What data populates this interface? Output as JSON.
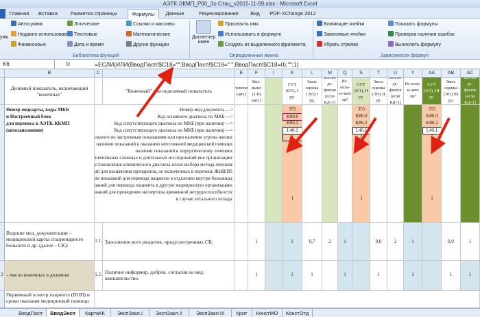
{
  "window": {
    "title": "АЭТК-ЭКМП_P00_Зх-Стац_v2015-11-09.xlsx - Microsoft Excel"
  },
  "ribbon_tabs": [
    "Главная",
    "Вставка",
    "Разметка страницы",
    "Формулы",
    "Данные",
    "Рецензирование",
    "Вид",
    "PDF-XChange 2012"
  ],
  "ribbon": {
    "lib": {
      "autosum": "Автосумма",
      "recent": "Недавно использовавше",
      "financial": "Финансовые",
      "logical": "Логические",
      "text": "Текстовые",
      "datetime": "Дата и время",
      "links": "Ссылки и массивы",
      "math": "Математические",
      "other": "Другие функции",
      "label": "Библиотека функций",
      "insert_fn": "ункци"
    },
    "names": {
      "manager": "Диспетчер имен",
      "assign": "Присвоить имя",
      "use": "Использовать в формуле",
      "create": "Создать из выделенного фрагмента",
      "label": "Определенные имена"
    },
    "audit": {
      "precedents": "Влияющие ячейки",
      "dependents": "Зависимые ячейки",
      "remove": "Убрать стрелки",
      "show": "Показать формулы",
      "check": "Проверка наличия ошибок",
      "evaluate": "Вычислить формулу",
      "label": "Зависимости формул"
    }
  },
  "formula_bar": {
    "name_box": "K6",
    "fx": "fx",
    "formula": "=ЕСЛИ(ИЛИ(ВводПасп!$C18=\"\";ВводПасп!$C18=\" \";ВводПасп!$C18=0);\"\";1)"
  },
  "columns": [
    "B",
    "C",
    "D",
    "E",
    "F",
    "I",
    "K",
    "L",
    "M",
    "Q",
    "S",
    "T",
    "U",
    "Y",
    "AA",
    "AB",
    "AC"
  ],
  "headers": {
    "col_b": "Делимый показатель, включающий \"конечные\"",
    "col_d": "\"Конечный\" или неделимый показатель",
    "col_e": "Отключен? (авт.)",
    "col_f": "Вкл. выкл (1/0) (авт.)",
    "sut1": "СУТ (0/1), I ур.",
    "eks1": "Эксп. оценка (ЭО) I ур.",
    "kol1": "Кол-во де-фектов (если КД>1)",
    "isp1": "Ис-поль-зо-вать ли?",
    "sut2": "СУТ (0/1), II ур.",
    "eks2": "Эксп. оценка (ЭО) II ур.",
    "kol2": "Кол-во де-фектов (если КД>1)",
    "isp2": "Ис-поль-зо-вать ли?",
    "sut3": "СУТ (0/1), III ур.",
    "eks3": "Эксп. оценка (ЭО) III ур.",
    "kol3": "Кол-во де-фектов (если КД>1)",
    "isp3": "Ис-поль-зо-вать ли?"
  },
  "left_labels": [
    "Номер медкарты, коды МКБ",
    "и Настроечный блок",
    "для переноса в АЭТК-ККМП",
    "(автозаполнение)"
  ],
  "right_labels": [
    "Номер мед.документа --->",
    "Код основного диагноза по МКБ --->",
    "Код сопутствующего диагноза по МКБ (при наличии) --->",
    "Код сопутствующего диагноза по МКБ (при наличии) --->",
    "поступления больного по экстренным показаниям или при наличии угрозы жизни:",
    "наличии показаний к оказанию неотложной медицинской помощи:",
    "наличии показаний к хирургическому лечению:",
    "необходимости проведения дополнительных сложных и длительных исследований вне организации:",
    "наличии затруднений установления клинического диагноза и/или выбора метода лечения:",
    "наличии показаний для назначения препаратов, не включенных в перечень ЖНВЛП:",
    "наличии показаний для перевода пациента в отделение внутри больницы:",
    "наличии показаний для перевода пациента в другую медицинскую организацию:",
    "наличии оснований для проведения экспертизы временной нетрудоспособности:",
    "в случае летального исхода:"
  ],
  "codes": {
    "doc": "355",
    "main": "K80.0",
    "sub1": "K86.2",
    "sub2": "L40.1",
    "one": "1"
  },
  "row1": {
    "b": "Ведение мед. документации – медицинской карты стационарного больного и др. (далее – СК):",
    "c": "1.1.",
    "d": "Заполнение всех разделов, предусмотренных СК;",
    "e": "",
    "f": "1",
    "sut1": "1",
    "eks1": "0,7",
    "kol1": "2",
    "isp1": "1",
    "sut2": "",
    "eks2": "0,8",
    "kol2": "2",
    "isp2": "1",
    "sut3": "",
    "eks3": "0,9",
    "kol3": "1",
    "isp3": "1"
  },
  "row2": {
    "a": "2",
    "b": "- число конечных в делимом",
    "c": "1.2.",
    "d": "Наличие информир. добров. согласия на мед. вмешательство.",
    "f": "1",
    "sut1": "1",
    "eks1": "1",
    "kol1": "",
    "isp1": "1",
    "sut2": "",
    "eks2": "1",
    "kol2": "",
    "isp2": "1",
    "sut3": "",
    "eks3": "1",
    "kol3": "",
    "isp3": "1"
  },
  "row3": {
    "b": "Первичный осмотр пациента (ПОП) и сроки оказания медицинской помощи"
  },
  "sheet_tabs": [
    "ВводПасп",
    "ВводЭксп",
    "КартаКК",
    "ЭкспЗакл.I",
    "ЭкспЗакл.II",
    "ЭкспЗакл.III",
    "Крит",
    "КонстМО",
    "КонстОтд"
  ],
  "colors": {
    "green_dark": "#6a8f2c",
    "green_light": "#d7e6bd",
    "orange": "#f9c9a8",
    "blue_light": "#d3e5ef",
    "arrow": "#e02010"
  }
}
